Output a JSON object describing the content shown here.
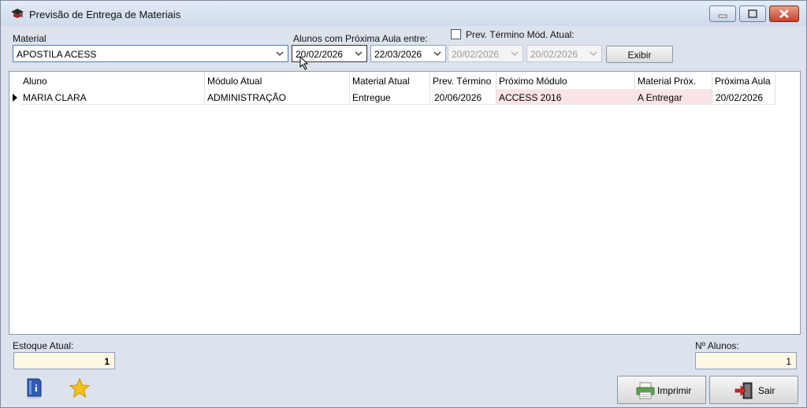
{
  "window": {
    "title": "Previsão de Entrega de Materiais"
  },
  "filters": {
    "material_label": "Material",
    "material_value": "APOSTILA ACESS",
    "next_class_label": "Alunos com Próxima Aula entre:",
    "date_from": "20/02/2026",
    "date_to": "22/03/2026",
    "prev_term_label": "Prev. Término Mód. Atual:",
    "prev_term_checked": false,
    "prev_from": "20/02/2026",
    "prev_to": "20/02/2026",
    "show_button": "Exibir"
  },
  "table": {
    "columns": [
      "Aluno",
      "Módulo Atual",
      "Material Atual",
      "Prev. Término",
      "Próximo Módulo",
      "Material Próx.",
      "Próxima Aula"
    ],
    "rows": [
      [
        "MARIA CLARA",
        "ADMINISTRAÇÃO",
        "Entregue",
        "20/06/2026",
        "ACCESS 2016",
        "A Entregar",
        "20/02/2026"
      ]
    ]
  },
  "footer": {
    "stock_label": "Estoque Atual:",
    "stock_value": "1",
    "students_label": "Nº Alunos:",
    "students_value": "1",
    "print_button": "Imprimir",
    "exit_button": "Sair"
  },
  "icons": {
    "app": "graduation-cap-icon",
    "help": "help-book-icon",
    "favorite": "star-icon",
    "print": "printer-icon",
    "exit": "exit-door-icon"
  },
  "colors": {
    "pink_cell": "#fbe4e6",
    "readonly_bg": "#fdf7e3",
    "close_button": "#c8402a"
  }
}
